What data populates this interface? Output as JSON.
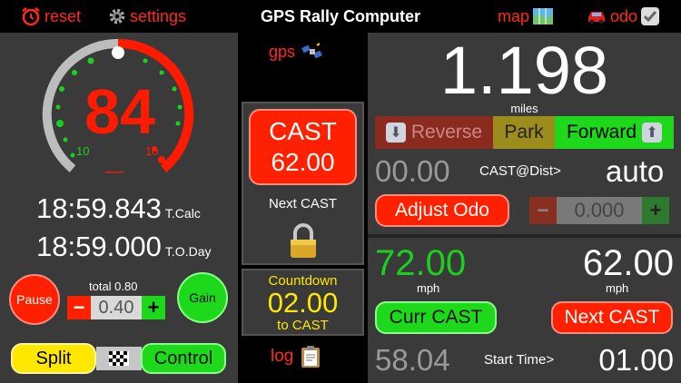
{
  "topbar": {
    "reset_label": "reset",
    "settings_label": "settings",
    "title": "GPS Rally Computer",
    "map_label": "map",
    "odo_label": "odo"
  },
  "speedo": {
    "value": "84",
    "scale_min": "10",
    "scale_max": "10",
    "underline": "_"
  },
  "times": {
    "calc_value": "18:59.843",
    "calc_label": "T.Calc",
    "day_value": "18:59.000",
    "day_label": "T.O.Day"
  },
  "controls": {
    "pause_label": "Pause",
    "gain_label": "Gain",
    "total_label": "total 0.80",
    "gain_value": "0.40",
    "minus": "−",
    "plus": "+",
    "split_label": "Split",
    "control_label": "Control"
  },
  "mid": {
    "gps_label": "gps",
    "cast_label": "CAST",
    "cast_value": "62.00",
    "next_cast_label": "Next CAST",
    "countdown_label": "Countdown",
    "countdown_value": "02.00",
    "to_cast_label": "to CAST",
    "log_label": "log"
  },
  "odo": {
    "distance": "1.198",
    "unit": "miles",
    "reverse_label": "Reverse",
    "park_label": "Park",
    "forward_label": "Forward",
    "cast_dist_value": "00.00",
    "cast_dist_label": "CAST@Dist>",
    "cast_dist_mode": "auto",
    "adjust_label": "Adjust Odo",
    "adjust_value": "0.000",
    "minus": "−",
    "plus": "+"
  },
  "speed": {
    "curr_value": "72.00",
    "curr_unit": "mph",
    "next_value": "62.00",
    "next_unit": "mph",
    "curr_cast_label": "Curr CAST",
    "next_cast_label": "Next CAST",
    "start_value": "58.04",
    "start_label": "Start Time>",
    "start_time": "01.00"
  },
  "colors": {
    "red": "#ff2000",
    "green": "#1dd81b",
    "yellow": "#ffe800",
    "panel": "#3a3a3a"
  }
}
